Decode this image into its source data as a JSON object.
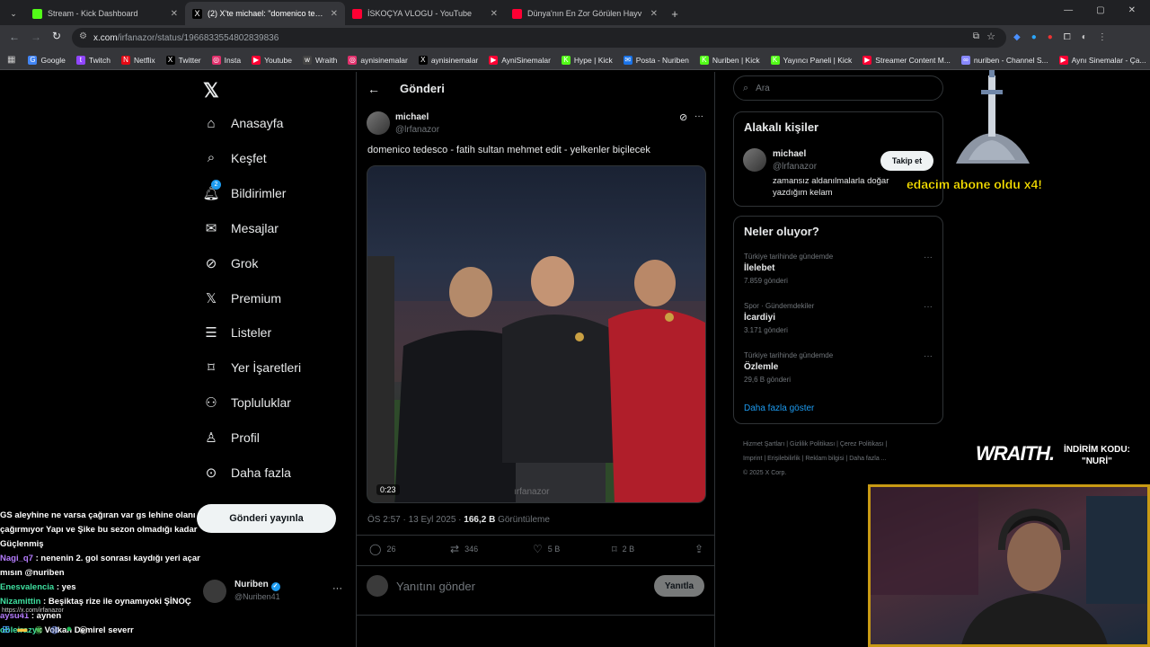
{
  "browser": {
    "tabs": [
      {
        "title": "Stream - Kick Dashboard",
        "color": "#53fc18"
      },
      {
        "title": "(2) X'te michael: \"domenico tedesco",
        "color": "#ffffff"
      },
      {
        "title": "İSKOÇYA VLOGU - YouTube",
        "color": "#ff0033"
      },
      {
        "title": "Dünya'nın En Zor Görülen Hayv",
        "color": "#ff0033"
      }
    ],
    "url_host": "x.com",
    "url_path": "/irfanazor/status/1966833554802839836",
    "bookmarks": [
      {
        "label": "Google",
        "color": "#4285f4",
        "glyph": "G"
      },
      {
        "label": "Twitch",
        "color": "#9146ff",
        "glyph": "t"
      },
      {
        "label": "Netflix",
        "color": "#e50914",
        "glyph": "N"
      },
      {
        "label": "Twitter",
        "color": "#000000",
        "glyph": "X"
      },
      {
        "label": "Insta",
        "color": "#e1306c",
        "glyph": "◎"
      },
      {
        "label": "Youtube",
        "color": "#ff0033",
        "glyph": "▶"
      },
      {
        "label": "Wraith",
        "color": "#444444",
        "glyph": "w"
      },
      {
        "label": "aynisinemalar",
        "color": "#e1306c",
        "glyph": "◎"
      },
      {
        "label": "aynisinemalar",
        "color": "#000000",
        "glyph": "X"
      },
      {
        "label": "AyniSinemalar",
        "color": "#ff0033",
        "glyph": "▶"
      },
      {
        "label": "Hype | Kick",
        "color": "#53fc18",
        "glyph": "K"
      },
      {
        "label": "Posta - Nuriben",
        "color": "#1a73e8",
        "glyph": "✉"
      },
      {
        "label": "Nuriben | Kick",
        "color": "#53fc18",
        "glyph": "K"
      },
      {
        "label": "Yayıncı Paneli | Kick",
        "color": "#53fc18",
        "glyph": "K"
      },
      {
        "label": "Streamer Content M...",
        "color": "#ff0033",
        "glyph": "▶"
      },
      {
        "label": "nuriben - Channel S...",
        "color": "#8888ff",
        "glyph": "∞"
      },
      {
        "label": "Aynı Sinemalar - Ça...",
        "color": "#ff0033",
        "glyph": "▶"
      }
    ]
  },
  "sidebar": {
    "items": [
      {
        "label": "Anasayfa",
        "icon": "home-icon"
      },
      {
        "label": "Keşfet",
        "icon": "search-icon"
      },
      {
        "label": "Bildirimler",
        "icon": "bell-icon",
        "badge": "2"
      },
      {
        "label": "Mesajlar",
        "icon": "mail-icon"
      },
      {
        "label": "Grok",
        "icon": "grok-icon"
      },
      {
        "label": "Premium",
        "icon": "x-logo-icon"
      },
      {
        "label": "Listeler",
        "icon": "list-icon"
      },
      {
        "label": "Yer İşaretleri",
        "icon": "bookmark-icon"
      },
      {
        "label": "Topluluklar",
        "icon": "people-icon"
      },
      {
        "label": "Profil",
        "icon": "user-icon"
      },
      {
        "label": "Daha fazla",
        "icon": "more-circle-icon"
      }
    ],
    "post_button": "Gönderi yayınla",
    "account": {
      "name": "Nuriben",
      "handle": "@Nuriben41"
    }
  },
  "post": {
    "header": "Gönderi",
    "author_name": "michael",
    "author_handle": "@lrfanazor",
    "text": "domenico tedesco - fatih sultan mehmet edit - yelkenler biçilecek",
    "video_duration": "0:23",
    "video_watermark": "ırfanazor",
    "time": "ÖS 2:57 · 13 Eyl 2025 · ",
    "views": "166,2 B",
    "views_label": " Görüntüleme",
    "replies": "26",
    "reposts": "346",
    "likes": "5 B",
    "bookmarks": "2 B",
    "reply_placeholder": "Yanıtını gönder",
    "reply_button": "Yanıtla"
  },
  "right": {
    "search_placeholder": "Ara",
    "related_title": "Alakalı kişiler",
    "related": {
      "name": "michael",
      "handle": "@lrfanazor",
      "bio": "zamansız aldanılmalarla doğar yazdığım kelam",
      "follow": "Takip et"
    },
    "trends_title": "Neler oluyor?",
    "trends": [
      {
        "category": "Türkiye tarihinde gündemde",
        "name": "İlelebet",
        "count": "7.859 gönderi"
      },
      {
        "category": "Spor · Gündemdekiler",
        "name": "İcardiyi",
        "count": "3.171 gönderi"
      },
      {
        "category": "Türkiye tarihinde gündemde",
        "name": "Özlemle",
        "count": "29,6 B gönderi"
      }
    ],
    "show_more": "Daha fazla göster",
    "footer_line1": "Hizmet Şartları   |   Gizlilik Politikası   |   Çerez Politikası   |",
    "footer_line2": "Imprint   |   Erişilebilirlik   |   Reklam bilgisi   |   Daha fazla ...",
    "footer_line3": "© 2025 X Corp."
  },
  "overlay": {
    "alert": "edacim abone oldu ",
    "alert_multiplier": "x4!",
    "brand": "WRAITH.",
    "promo_line1": "İNDİRİM KODU:",
    "promo_line2": "\"NURİ\""
  },
  "chat": [
    {
      "user": "",
      "user_color": "#ffffff",
      "text": "GS aleyhine ne varsa çağıran var gs lehine olanı çağırmıyor Yapı ve Şike bu sezon olmadığı kadar Güçlenmiş"
    },
    {
      "user": "Nagi_q7",
      "user_color": "#b57cff",
      "text": " : nenenin 2. gol sonrası kaydığı yeri açar mısın @nuriben"
    },
    {
      "user": "Enesvalencia",
      "user_color": "#3fe0a0",
      "text": " : yes"
    },
    {
      "user": "Nizamittin",
      "user_color": "#3fe0a0",
      "text": " : Beşiktaş rize ile oynamıyoki ŞİNOÇ"
    },
    {
      "user": "aysu41",
      "user_color": "#b57cff",
      "text": " : aynen"
    },
    {
      "user": "obleirazy",
      "user_color": "#3fe0a0",
      "text": " : Volkan Demirel severr"
    }
  ],
  "statusbar_url": "https://x.com/irfanazor"
}
